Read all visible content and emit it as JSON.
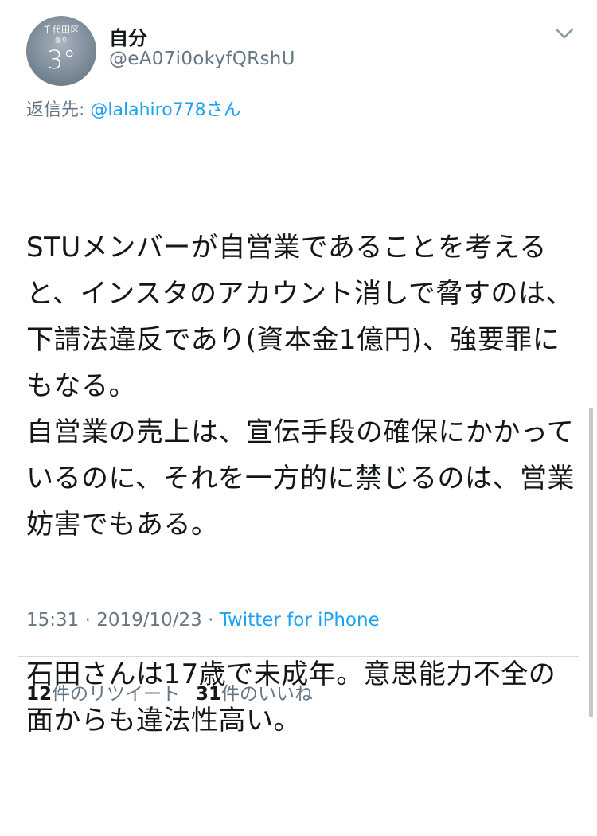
{
  "avatar": {
    "city": "千代田区",
    "weather": "曇り",
    "temperature": "3°"
  },
  "author": {
    "display_name": "自分",
    "handle": "@eA07i0okyfQRshU"
  },
  "reply": {
    "prefix": "返信先: ",
    "mention": "@lalahiro778さん"
  },
  "tweet": {
    "paragraph1": "STUメンバーが自営業であることを考えると、インスタのアカウント消しで脅すのは、下請法違反であり(資本金1億円)、強要罪にもなる。\n自営業の売上は、宣伝手段の確保にかかっているのに、それを一方的に禁じるのは、営業妨害でもある。",
    "paragraph2": "石田さんは17歳で未成年。意思能力不全の面からも違法性高い。"
  },
  "meta": {
    "time": "15:31",
    "separator": " · ",
    "date": "2019/10/23",
    "source": "Twitter for iPhone"
  },
  "stats": {
    "retweets_count": "12",
    "retweets_label": "件のリツイート",
    "likes_count": "31",
    "likes_label": "件のいいね"
  },
  "icons": {
    "menu": "chevron-down-icon"
  },
  "colors": {
    "link": "#1da1f2",
    "secondary_text": "#657786",
    "primary_text": "#14171a"
  }
}
